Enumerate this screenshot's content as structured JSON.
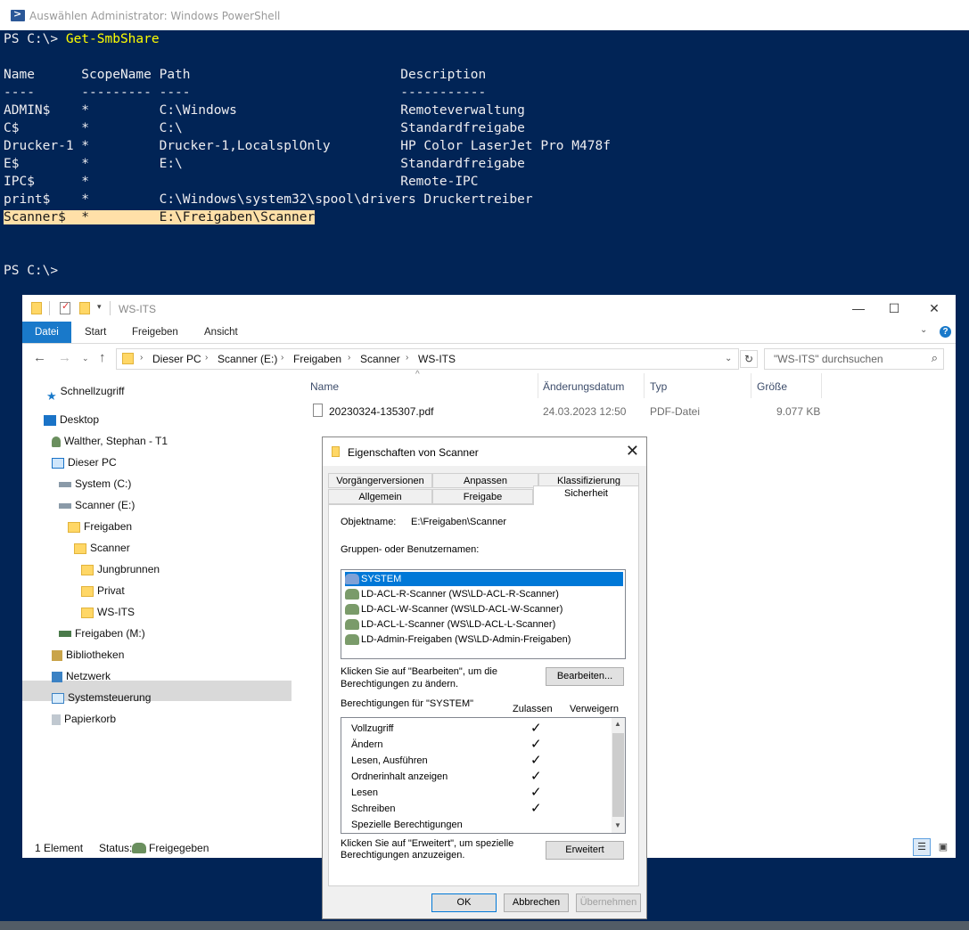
{
  "powershell": {
    "title": "Auswählen Administrator: Windows PowerShell",
    "prompt": "PS C:\\> ",
    "command": "Get-SmbShare",
    "header": "Name      ScopeName Path                           Description",
    "underline": "----      --------- ----                           -----------",
    "rows": [
      "ADMIN$    *         C:\\Windows                     Remoteverwaltung",
      "C$        *         C:\\                            Standardfreigabe",
      "Drucker-1 *         Drucker-1,LocalsplOnly         HP Color LaserJet Pro M478f",
      "E$        *         E:\\                            Standardfreigabe",
      "IPC$      *                                        Remote-IPC",
      "print$    *         C:\\Windows\\system32\\spool\\drivers Druckertreiber"
    ],
    "highlighted_row": "Scanner$  *         E:\\Freigaben\\Scanner",
    "final_prompt": "PS C:\\>"
  },
  "explorer": {
    "title": "WS-ITS",
    "ribbon_tabs": [
      "Datei",
      "Start",
      "Freigeben",
      "Ansicht"
    ],
    "breadcrumb": [
      "Dieser PC",
      "Scanner (E:)",
      "Freigaben",
      "Scanner",
      "WS-ITS"
    ],
    "search_placeholder": "\"WS-ITS\" durchsuchen",
    "nav": {
      "quick": "Schnellzugriff",
      "desktop": "Desktop",
      "user": "Walther, Stephan - T1",
      "thispc": "Dieser PC",
      "system": "System (C:)",
      "scanner_drive": "Scanner (E:)",
      "freigaben": "Freigaben",
      "scanner": "Scanner",
      "jungbrunnen": "Jungbrunnen",
      "privat": "Privat",
      "wsits": "WS-ITS",
      "freigaben_m": "Freigaben (M:)",
      "bibliotheken": "Bibliotheken",
      "netzwerk": "Netzwerk",
      "systemsteuerung": "Systemsteuerung",
      "papierkorb": "Papierkorb"
    },
    "columns": {
      "name": "Name",
      "date": "Änderungsdatum",
      "type": "Typ",
      "size": "Größe"
    },
    "file": {
      "name": "20230324-135307.pdf",
      "date": "24.03.2023 12:50",
      "type": "PDF-Datei",
      "size": "9.077 KB"
    },
    "status": {
      "count": "1 Element",
      "status_label": "Status:",
      "status_value": "Freigegeben"
    }
  },
  "dialog": {
    "title": "Eigenschaften von Scanner",
    "tabs_row1": [
      "Vorgängerversionen",
      "Anpassen",
      "Klassifizierung"
    ],
    "tabs_row2": [
      "Allgemein",
      "Freigabe",
      "Sicherheit"
    ],
    "object_label": "Objektname:",
    "object_value": "E:\\Freigaben\\Scanner",
    "groups_label": "Gruppen- oder Benutzernamen:",
    "users": [
      "SYSTEM",
      "LD-ACL-R-Scanner (WS\\LD-ACL-R-Scanner)",
      "LD-ACL-W-Scanner (WS\\LD-ACL-W-Scanner)",
      "LD-ACL-L-Scanner (WS\\LD-ACL-L-Scanner)",
      "LD-Admin-Freigaben (WS\\LD-Admin-Freigaben)"
    ],
    "edit_hint_1": "Klicken Sie auf \"Bearbeiten\", um die",
    "edit_hint_2": "Berechtigungen zu ändern.",
    "edit_button": "Bearbeiten...",
    "perm_for": "Berechtigungen für \"SYSTEM\"",
    "allow_label": "Zulassen",
    "deny_label": "Verweigern",
    "permissions": [
      {
        "name": "Vollzugriff",
        "allow": true
      },
      {
        "name": "Ändern",
        "allow": true
      },
      {
        "name": "Lesen, Ausführen",
        "allow": true
      },
      {
        "name": "Ordnerinhalt anzeigen",
        "allow": true
      },
      {
        "name": "Lesen",
        "allow": true
      },
      {
        "name": "Schreiben",
        "allow": true
      },
      {
        "name": "Spezielle Berechtigungen",
        "allow": false
      }
    ],
    "check_mark": "✓",
    "adv_hint_1": "Klicken Sie auf \"Erweitert\", um spezielle",
    "adv_hint_2": "Berechtigungen anzuzeigen.",
    "advanced_button": "Erweitert",
    "ok_button": "OK",
    "cancel_button": "Abbrechen",
    "apply_button": "Übernehmen"
  }
}
